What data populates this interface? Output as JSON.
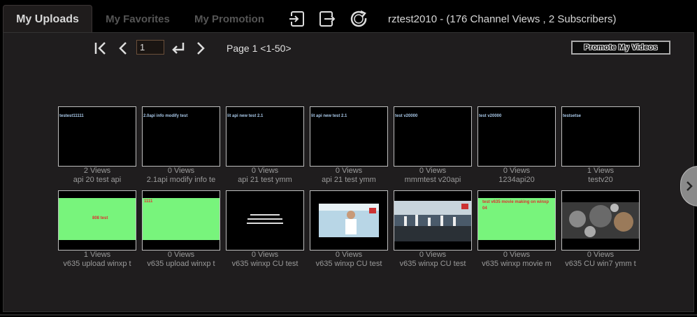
{
  "tabs": [
    {
      "label": "My Uploads",
      "active": true
    },
    {
      "label": "My Favorites",
      "active": false
    },
    {
      "label": "My Promotion",
      "active": false
    }
  ],
  "toolbar_icons": [
    "login-icon",
    "logout-icon",
    "refresh-icon"
  ],
  "channel_info": "rztest2010 - (176 Channel Views , 2 Subscribers)",
  "pager": {
    "page_input": "1",
    "page_label": "Page 1 <1-50>",
    "icons": [
      "first-page-icon",
      "prev-page-icon",
      "go-page-icon",
      "next-page-icon"
    ]
  },
  "promote_button": "Promote My Videos",
  "videos": [
    {
      "views": "2 Views",
      "title": "api 20 test api",
      "thumb_text": "testest11111",
      "thumb_style": "black"
    },
    {
      "views": "0 Views",
      "title": "2.1api modify info te",
      "thumb_text": "2.0api info modify test",
      "thumb_style": "black"
    },
    {
      "views": "0 Views",
      "title": "api 21 test ymm",
      "thumb_text": "lit api new test 2.1",
      "thumb_style": "black"
    },
    {
      "views": "0 Views",
      "title": "api 21 test ymm",
      "thumb_text": "lit api new test 2.1",
      "thumb_style": "black"
    },
    {
      "views": "0 Views",
      "title": "mmmtest v20api",
      "thumb_text": "test v20000",
      "thumb_style": "black"
    },
    {
      "views": "0 Views",
      "title": "1234api20",
      "thumb_text": "test v20000",
      "thumb_style": "black"
    },
    {
      "views": "1 Views",
      "title": "testv20",
      "thumb_text": "testsetse",
      "thumb_style": "black"
    },
    {
      "views": "1 Views",
      "title": "v635 upload winxp t",
      "thumb_text": "808 test",
      "thumb_style": "green-center"
    },
    {
      "views": "0 Views",
      "title": "v635 upload winxp t",
      "thumb_text": "1111",
      "thumb_style": "green-corner"
    },
    {
      "views": "0 Views",
      "title": "v635 winxp CU test",
      "thumb_text": "",
      "thumb_style": "black-chinese"
    },
    {
      "views": "0 Views",
      "title": "v635 winxp CU test",
      "thumb_text": "",
      "thumb_style": "photo-person"
    },
    {
      "views": "0 Views",
      "title": "v635 winxp CU test",
      "thumb_text": "",
      "thumb_style": "photo-dance"
    },
    {
      "views": "0 Views",
      "title": "v635 winxp movie m",
      "thumb_text": "test v635 movie making on winxp 04",
      "thumb_style": "green-lines"
    },
    {
      "views": "0 Views",
      "title": "v635 CU win7 ymm t",
      "thumb_text": "",
      "thumb_style": "photo-gears"
    }
  ],
  "side_arrow": "next-panel-icon"
}
